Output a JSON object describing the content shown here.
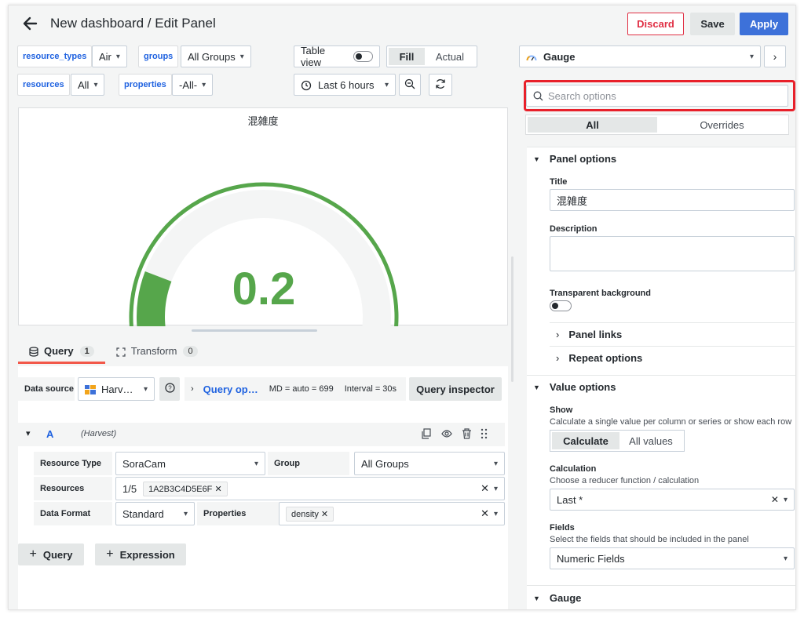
{
  "header": {
    "title": "New dashboard / Edit Panel",
    "discard_label": "Discard",
    "save_label": "Save",
    "apply_label": "Apply"
  },
  "variables": [
    {
      "name": "resource_types",
      "value": "Air"
    },
    {
      "name": "groups",
      "value": "All Groups"
    },
    {
      "name": "resources",
      "value": "All"
    },
    {
      "name": "properties",
      "value": "-All-"
    }
  ],
  "toolbar": {
    "table_view_label": "Table view",
    "fill_label": "Fill",
    "actual_label": "Actual",
    "time_range": "Last 6 hours"
  },
  "panel": {
    "title": "混雑度",
    "value": "0.2",
    "gauge_fraction": 0.2,
    "colors": {
      "threshold": "#56a64b",
      "track": "#f4f5f5"
    }
  },
  "tabs": {
    "query_label": "Query",
    "query_count": "1",
    "transform_label": "Transform",
    "transform_count": "0"
  },
  "datasource": {
    "label": "Data source",
    "value": "Harv…",
    "query_options_label": "Query op…",
    "md_info": "MD = auto = 699",
    "interval_info": "Interval = 30s",
    "inspector_label": "Query inspector"
  },
  "query": {
    "ref_id": "A",
    "source": "(Harvest)",
    "resource_type_label": "Resource Type",
    "resource_type_value": "SoraCam",
    "group_label": "Group",
    "group_value": "All Groups",
    "resources_label": "Resources",
    "resources_count": "1/5",
    "resources_chip": "1A2B3C4D5E6F",
    "data_format_label": "Data Format",
    "data_format_value": "Standard",
    "properties_label": "Properties",
    "properties_chip": "density"
  },
  "add_buttons": {
    "query_label": "Query",
    "expression_label": "Expression"
  },
  "sidebar": {
    "viz_name": "Gauge",
    "search_placeholder": "Search options",
    "tab_all": "All",
    "tab_overrides": "Overrides",
    "panel_options_title": "Panel options",
    "title_label": "Title",
    "title_value": "混雑度",
    "description_label": "Description",
    "transparent_label": "Transparent background",
    "panel_links_label": "Panel links",
    "repeat_options_label": "Repeat options",
    "value_options_title": "Value options",
    "show_label": "Show",
    "show_desc": "Calculate a single value per column or series or show each row",
    "calculate_label": "Calculate",
    "all_values_label": "All values",
    "calculation_label": "Calculation",
    "calculation_desc": "Choose a reducer function / calculation",
    "calculation_value": "Last *",
    "fields_label": "Fields",
    "fields_desc": "Select the fields that should be included in the panel",
    "fields_value": "Numeric Fields",
    "gauge_title": "Gauge"
  },
  "colors": {
    "apply": "#3d71d9",
    "discard_text": "#e02f44",
    "link_blue": "#1f62e0",
    "highlight_red": "#e8202a",
    "tab_underline": "#f2584a"
  }
}
